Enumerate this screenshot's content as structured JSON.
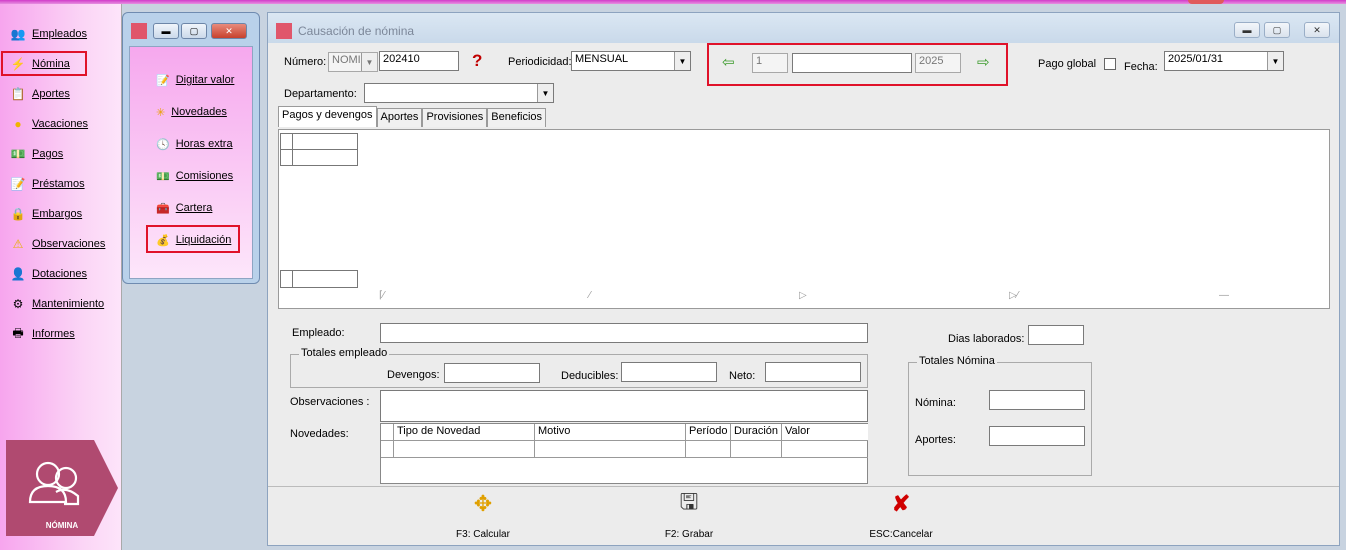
{
  "sidebar": {
    "items": [
      {
        "label": "Empleados",
        "icon": "employees-icon"
      },
      {
        "label": "Nómina",
        "icon": "payroll-icon"
      },
      {
        "label": "Aportes",
        "icon": "contributions-icon"
      },
      {
        "label": "Vacaciones",
        "icon": "vacation-icon"
      },
      {
        "label": "Pagos",
        "icon": "payments-icon"
      },
      {
        "label": "Préstamos",
        "icon": "loans-icon"
      },
      {
        "label": "Embargos",
        "icon": "lock-icon"
      },
      {
        "label": "Observaciones",
        "icon": "warning-icon"
      },
      {
        "label": "Dotaciones",
        "icon": "uniform-icon"
      },
      {
        "label": "Mantenimiento",
        "icon": "gear-icon"
      },
      {
        "label": "Informes",
        "icon": "printer-icon"
      }
    ],
    "logo_label": "NÓMINA"
  },
  "submenu": {
    "items": [
      {
        "label": "Digitar valor",
        "icon": "edit-icon"
      },
      {
        "label": "Novedades",
        "icon": "news-icon"
      },
      {
        "label": "Horas extra",
        "icon": "clock-icon"
      },
      {
        "label": "Comisiones",
        "icon": "money-icon"
      },
      {
        "label": "Cartera",
        "icon": "wallet-icon"
      },
      {
        "label": "Liquidación",
        "icon": "calculator-icon"
      }
    ]
  },
  "window": {
    "title": "Causación de nómina",
    "numero_label": "Número:",
    "numero_prefix": "NOMI",
    "numero_value": "202410",
    "periodicidad_label": "Periodicidad:",
    "periodicidad_value": "MENSUAL",
    "period_num": "1",
    "period_name": "",
    "period_year": "2025",
    "pago_global_label": "Pago global",
    "fecha_label": "Fecha:",
    "fecha_value": "2025/01/31",
    "departamento_label": "Departamento:",
    "departamento_value": ""
  },
  "tabs": [
    "Pagos y devengos",
    "Aportes",
    "Provisiones",
    "Beneficios"
  ],
  "detail": {
    "empleado_label": "Empleado:",
    "dias_label": "Dias laborados:",
    "totales_empleado_label": "Totales empleado",
    "devengos_label": "Devengos:",
    "deducibles_label": "Deducibles:",
    "neto_label": "Neto:",
    "observaciones_label": "Observaciones :",
    "novedades_label": "Novedades:",
    "totales_nomina_label": "Totales Nómina",
    "nomina_label": "Nómina:",
    "aportes_label": "Aportes:"
  },
  "novedades_columns": [
    "Tipo de Novedad",
    "Motivo",
    "Período",
    "Duración",
    "Valor"
  ],
  "footer": {
    "calcular": "F3: Calcular",
    "grabar": "F2: Grabar",
    "cancelar": "ESC:Cancelar"
  },
  "colors": {
    "accent_red": "#e0122a",
    "sidebar_pink": "#f7a5ee",
    "logo": "#b04a70"
  }
}
